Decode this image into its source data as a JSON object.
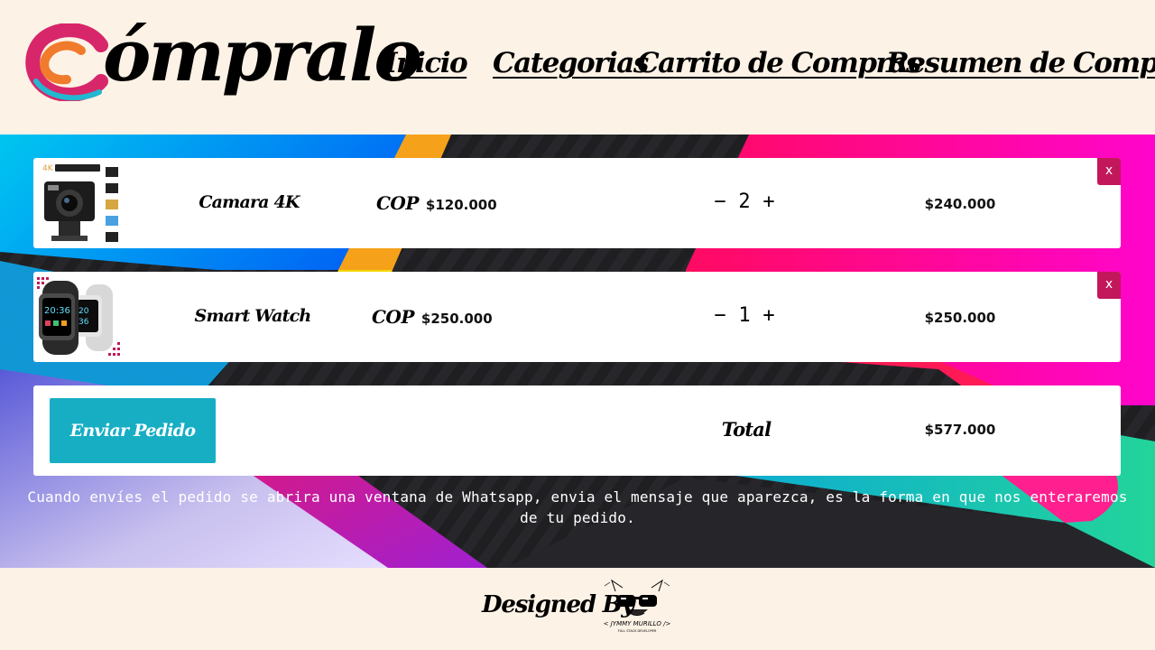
{
  "brand": {
    "name": "ómpralo"
  },
  "nav": {
    "items": [
      "Inicio",
      "Categorias",
      "Carrito de Compras",
      "Resumen de Compras"
    ]
  },
  "cart": {
    "items": [
      {
        "name": "Camara 4K",
        "currency": "COP",
        "price": "$120.000",
        "qty_minus": "−",
        "quantity": "2",
        "qty_plus": "+",
        "subtotal": "$240.000",
        "remove": "x"
      },
      {
        "name": "Smart Watch",
        "currency": "COP",
        "price": "$250.000",
        "qty_minus": "−",
        "quantity": "1",
        "qty_plus": "+",
        "subtotal": "$250.000",
        "remove": "x"
      }
    ],
    "send_button": "Enviar Pedido",
    "total_label": "Total",
    "total_value": "$577.000",
    "notice": "Cuando envíes el pedido se abrira una ventana de Whatsapp, envia el mensaje que aparezca, es la forma en que nos enteraremos de tu pedido."
  },
  "footer": {
    "designed_by": "Designed By",
    "signature_name": "< JYMMY MURILLO />",
    "signature_sub": "FULL STACK DEVELOPER"
  },
  "icons": [
    "brand-c-logo-icon",
    "camera-product-image",
    "smartwatch-product-image",
    "cat-sunglasses-icon"
  ],
  "colors": {
    "page_bg": "#fdf2e6",
    "send_button": "#17aec4",
    "remove_button": "#c2185b",
    "brand_pink": "#d8266a",
    "brand_orange": "#f07b2c",
    "brand_cyan": "#22b8cf"
  }
}
